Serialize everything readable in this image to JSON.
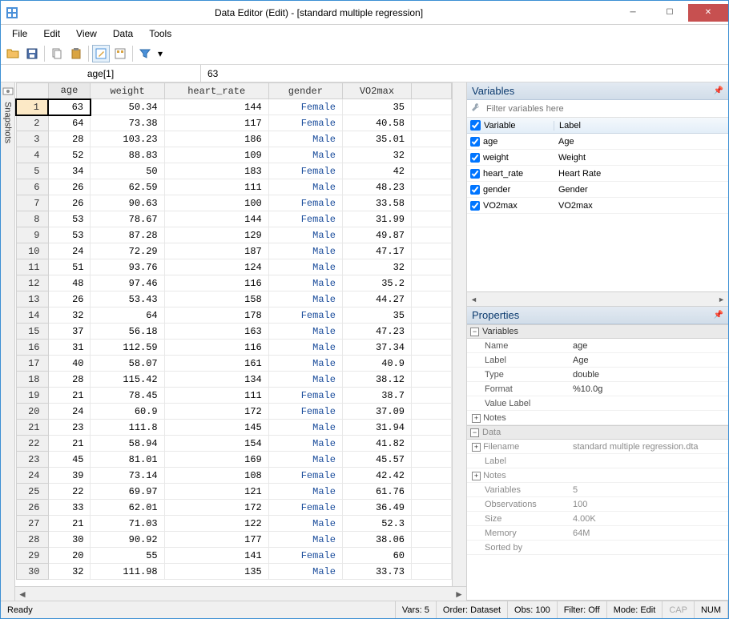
{
  "window": {
    "title": "Data Editor (Edit) - [standard multiple regression]"
  },
  "menu": [
    "File",
    "Edit",
    "View",
    "Data",
    "Tools"
  ],
  "formula": {
    "cell": "age[1]",
    "value": "63"
  },
  "snapshots_label": "Snapshots",
  "columns": [
    "age",
    "weight",
    "heart_rate",
    "gender",
    "VO2max"
  ],
  "rows": [
    {
      "n": 1,
      "age": 63,
      "weight": "50.34",
      "heart_rate": 144,
      "gender": "Female",
      "vo2": "35"
    },
    {
      "n": 2,
      "age": 64,
      "weight": "73.38",
      "heart_rate": 117,
      "gender": "Female",
      "vo2": "40.58"
    },
    {
      "n": 3,
      "age": 28,
      "weight": "103.23",
      "heart_rate": 186,
      "gender": "Male",
      "vo2": "35.01"
    },
    {
      "n": 4,
      "age": 52,
      "weight": "88.83",
      "heart_rate": 109,
      "gender": "Male",
      "vo2": "32"
    },
    {
      "n": 5,
      "age": 34,
      "weight": "50",
      "heart_rate": 183,
      "gender": "Female",
      "vo2": "42"
    },
    {
      "n": 6,
      "age": 26,
      "weight": "62.59",
      "heart_rate": 111,
      "gender": "Male",
      "vo2": "48.23"
    },
    {
      "n": 7,
      "age": 26,
      "weight": "90.63",
      "heart_rate": 100,
      "gender": "Female",
      "vo2": "33.58"
    },
    {
      "n": 8,
      "age": 53,
      "weight": "78.67",
      "heart_rate": 144,
      "gender": "Female",
      "vo2": "31.99"
    },
    {
      "n": 9,
      "age": 53,
      "weight": "87.28",
      "heart_rate": 129,
      "gender": "Male",
      "vo2": "49.87"
    },
    {
      "n": 10,
      "age": 24,
      "weight": "72.29",
      "heart_rate": 187,
      "gender": "Male",
      "vo2": "47.17"
    },
    {
      "n": 11,
      "age": 51,
      "weight": "93.76",
      "heart_rate": 124,
      "gender": "Male",
      "vo2": "32"
    },
    {
      "n": 12,
      "age": 48,
      "weight": "97.46",
      "heart_rate": 116,
      "gender": "Male",
      "vo2": "35.2"
    },
    {
      "n": 13,
      "age": 26,
      "weight": "53.43",
      "heart_rate": 158,
      "gender": "Male",
      "vo2": "44.27"
    },
    {
      "n": 14,
      "age": 32,
      "weight": "64",
      "heart_rate": 178,
      "gender": "Female",
      "vo2": "35"
    },
    {
      "n": 15,
      "age": 37,
      "weight": "56.18",
      "heart_rate": 163,
      "gender": "Male",
      "vo2": "47.23"
    },
    {
      "n": 16,
      "age": 31,
      "weight": "112.59",
      "heart_rate": 116,
      "gender": "Male",
      "vo2": "37.34"
    },
    {
      "n": 17,
      "age": 40,
      "weight": "58.07",
      "heart_rate": 161,
      "gender": "Male",
      "vo2": "40.9"
    },
    {
      "n": 18,
      "age": 28,
      "weight": "115.42",
      "heart_rate": 134,
      "gender": "Male",
      "vo2": "38.12"
    },
    {
      "n": 19,
      "age": 21,
      "weight": "78.45",
      "heart_rate": 111,
      "gender": "Female",
      "vo2": "38.7"
    },
    {
      "n": 20,
      "age": 24,
      "weight": "60.9",
      "heart_rate": 172,
      "gender": "Female",
      "vo2": "37.09"
    },
    {
      "n": 21,
      "age": 23,
      "weight": "111.8",
      "heart_rate": 145,
      "gender": "Male",
      "vo2": "31.94"
    },
    {
      "n": 22,
      "age": 21,
      "weight": "58.94",
      "heart_rate": 154,
      "gender": "Male",
      "vo2": "41.82"
    },
    {
      "n": 23,
      "age": 45,
      "weight": "81.01",
      "heart_rate": 169,
      "gender": "Male",
      "vo2": "45.57"
    },
    {
      "n": 24,
      "age": 39,
      "weight": "73.14",
      "heart_rate": 108,
      "gender": "Female",
      "vo2": "42.42"
    },
    {
      "n": 25,
      "age": 22,
      "weight": "69.97",
      "heart_rate": 121,
      "gender": "Male",
      "vo2": "61.76"
    },
    {
      "n": 26,
      "age": 33,
      "weight": "62.01",
      "heart_rate": 172,
      "gender": "Female",
      "vo2": "36.49"
    },
    {
      "n": 27,
      "age": 21,
      "weight": "71.03",
      "heart_rate": 122,
      "gender": "Male",
      "vo2": "52.3"
    },
    {
      "n": 28,
      "age": 30,
      "weight": "90.92",
      "heart_rate": 177,
      "gender": "Male",
      "vo2": "38.06"
    },
    {
      "n": 29,
      "age": 20,
      "weight": "55",
      "heart_rate": 141,
      "gender": "Female",
      "vo2": "60"
    },
    {
      "n": 30,
      "age": 32,
      "weight": "111.98",
      "heart_rate": 135,
      "gender": "Male",
      "vo2": "33.73"
    }
  ],
  "variables_panel": {
    "title": "Variables",
    "filter_placeholder": "Filter variables here",
    "hdr_variable": "Variable",
    "hdr_label": "Label",
    "items": [
      {
        "name": "age",
        "label": "Age"
      },
      {
        "name": "weight",
        "label": "Weight"
      },
      {
        "name": "heart_rate",
        "label": "Heart Rate"
      },
      {
        "name": "gender",
        "label": "Gender"
      },
      {
        "name": "VO2max",
        "label": "VO2max"
      }
    ]
  },
  "properties_panel": {
    "title": "Properties",
    "sections": {
      "variables": {
        "title": "Variables",
        "rows": {
          "name_k": "Name",
          "name_v": "age",
          "label_k": "Label",
          "label_v": "Age",
          "type_k": "Type",
          "type_v": "double",
          "format_k": "Format",
          "format_v": "%10.0g",
          "vlabel_k": "Value Label",
          "vlabel_v": "",
          "notes_k": "Notes"
        }
      },
      "data": {
        "title": "Data",
        "rows": {
          "fname_k": "Filename",
          "fname_v": "standard multiple regression.dta",
          "label_k": "Label",
          "label_v": "",
          "notes_k": "Notes",
          "vars_k": "Variables",
          "vars_v": "5",
          "obs_k": "Observations",
          "obs_v": "100",
          "size_k": "Size",
          "size_v": "4.00K",
          "mem_k": "Memory",
          "mem_v": "64M",
          "sort_k": "Sorted by",
          "sort_v": ""
        }
      }
    }
  },
  "status": {
    "ready": "Ready",
    "vars": "Vars: 5",
    "order": "Order: Dataset",
    "obs": "Obs: 100",
    "filter": "Filter: Off",
    "mode": "Mode: Edit",
    "cap": "CAP",
    "num": "NUM"
  }
}
